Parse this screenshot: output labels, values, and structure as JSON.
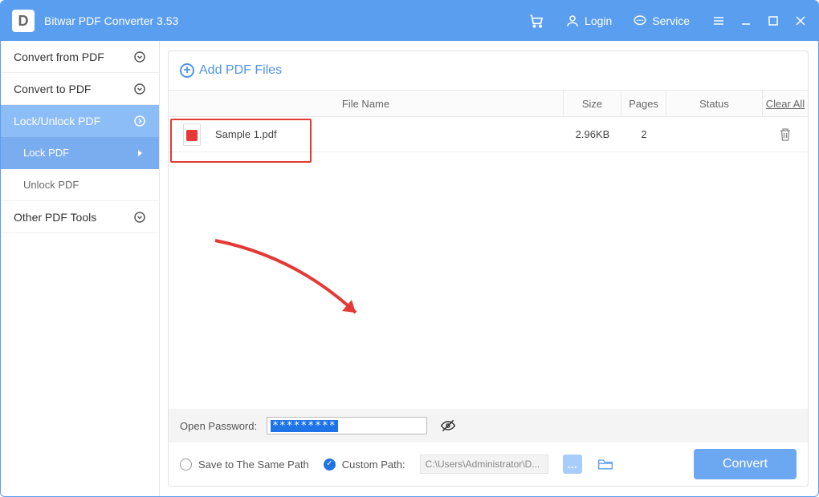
{
  "titlebar": {
    "logo_letter": "D",
    "title": "Bitwar PDF Converter 3.53",
    "login_label": "Login",
    "service_label": "Service"
  },
  "sidebar": {
    "convert_from": "Convert from PDF",
    "convert_to": "Convert to PDF",
    "lock_unlock": "Lock/Unlock PDF",
    "lock_pdf": "Lock PDF",
    "unlock_pdf": "Unlock PDF",
    "other_tools": "Other PDF Tools"
  },
  "main": {
    "add_label": "Add PDF Files",
    "headers": {
      "name": "File Name",
      "size": "Size",
      "pages": "Pages",
      "status": "Status",
      "clear": "Clear All"
    },
    "file": {
      "name": "Sample 1.pdf",
      "size": "2.96KB",
      "pages": "2"
    },
    "password_label": "Open Password:",
    "password_value": "*********",
    "same_path_label": "Save to The Same Path",
    "custom_path_label": "Custom Path:",
    "custom_path_value": "C:\\Users\\Administrator\\D...",
    "convert_label": "Convert"
  }
}
